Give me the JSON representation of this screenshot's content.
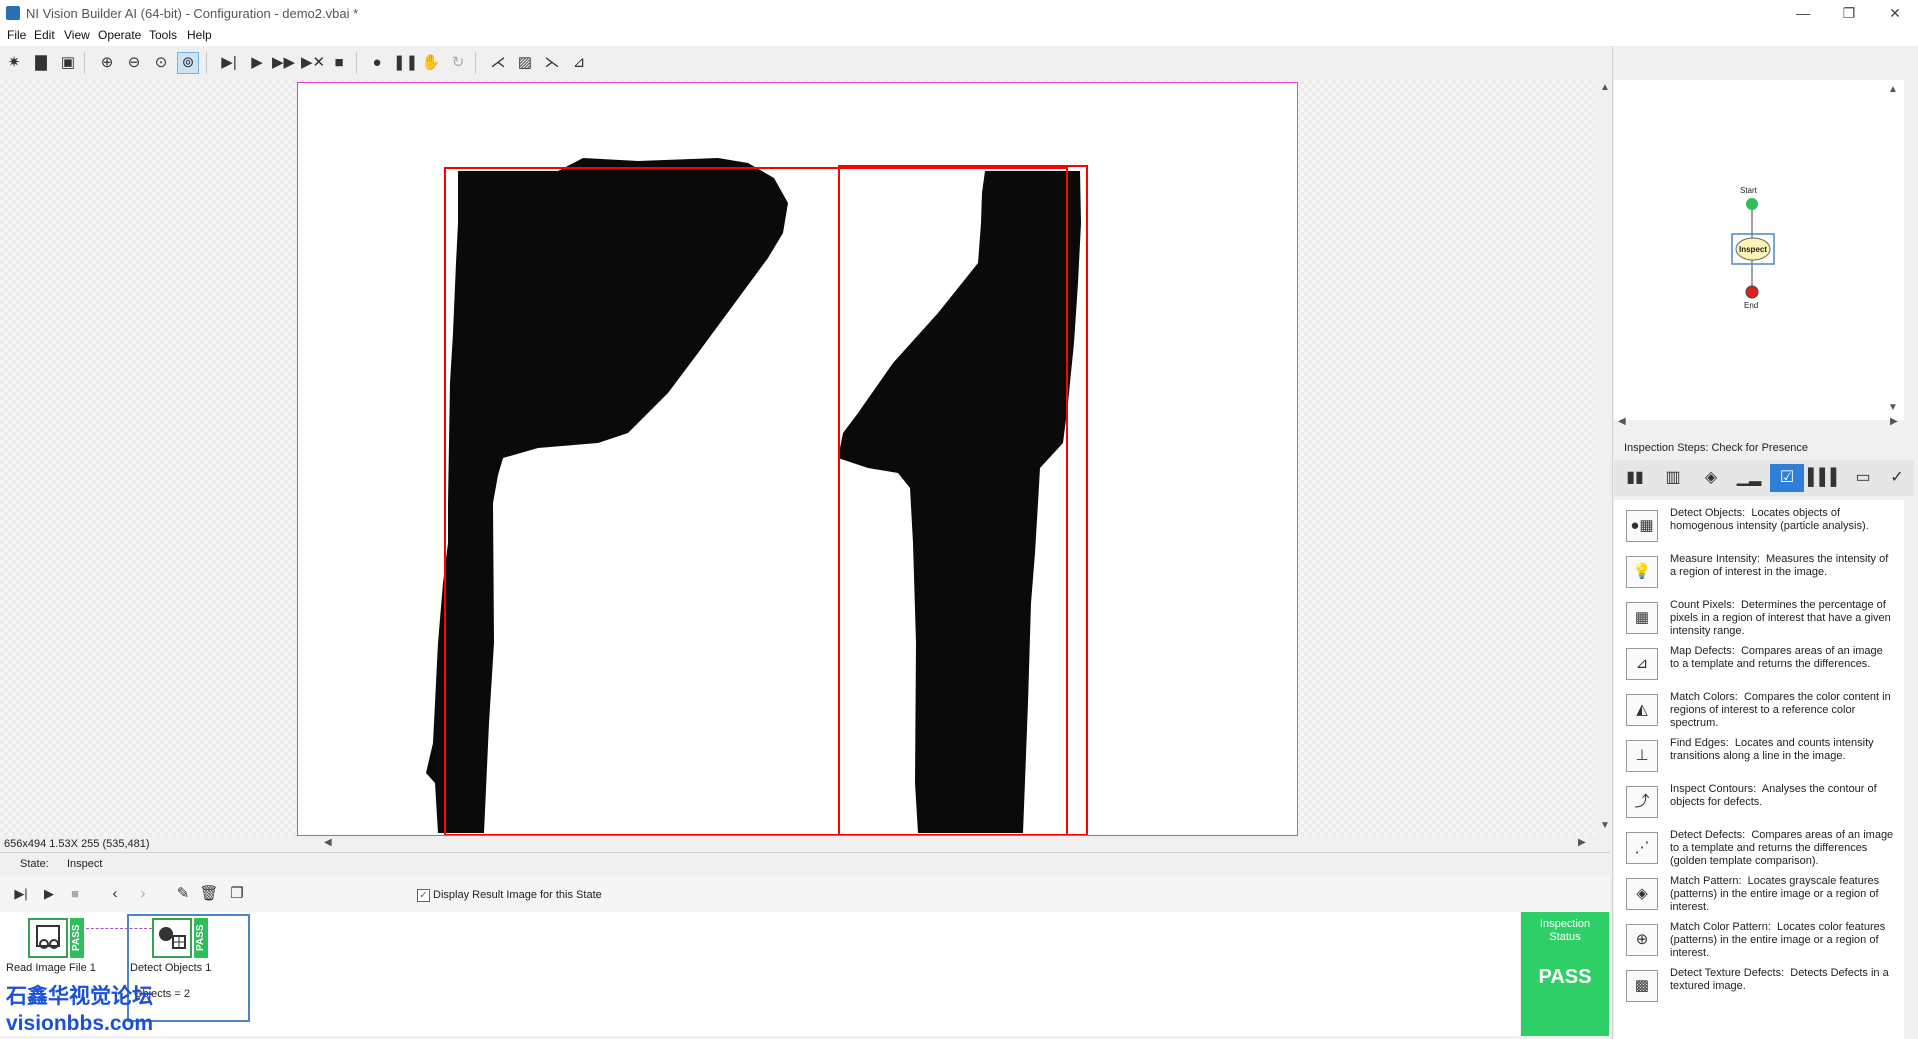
{
  "window": {
    "title": "NI Vision Builder AI (64-bit) - Configuration - demo2.vbai *",
    "min": "—",
    "restore": "❐",
    "close": "✕"
  },
  "menu": [
    "File",
    "Edit",
    "View",
    "Operate",
    "Tools",
    "Help"
  ],
  "viewer": {
    "readout": "656x494 1.53X 255    (535,481)"
  },
  "state": {
    "label": "State:",
    "value": "Inspect",
    "display_result_label": "Display Result Image for this State",
    "display_result_checked": true
  },
  "steps": [
    {
      "name": "Read Image File 1",
      "status": "PASS",
      "icon": "read-image-icon"
    },
    {
      "name": "Detect Objects 1",
      "status": "PASS",
      "icon": "detect-objects-icon",
      "result": "Objects = 2"
    }
  ],
  "inspection_status": {
    "label": "Inspection Status",
    "value": "PASS"
  },
  "flow": {
    "start": "Start",
    "state": "Inspect",
    "end": "End"
  },
  "palette": {
    "title": "Inspection Steps: Check for Presence",
    "items": [
      {
        "name": "Detect Objects:",
        "desc": "Locates objects of homogenous intensity (particle analysis).",
        "icon": "detect-objects-icon"
      },
      {
        "name": "Measure Intensity:",
        "desc": "Measures the intensity of a region of interest in the image.",
        "icon": "measure-intensity-icon"
      },
      {
        "name": "Count Pixels:",
        "desc": "Determines the percentage of pixels in a region of interest that have a given intensity range.",
        "icon": "count-pixels-icon"
      },
      {
        "name": "Map Defects:",
        "desc": "Compares areas of an image to a template and returns the differences.",
        "icon": "map-defects-icon"
      },
      {
        "name": "Match Colors:",
        "desc": "Compares the color content in regions of interest to a reference color spectrum.",
        "icon": "match-colors-icon"
      },
      {
        "name": "Find Edges:",
        "desc": "Locates and counts intensity transitions along a line in the image.",
        "icon": "find-edges-icon"
      },
      {
        "name": "Inspect Contours:",
        "desc": "Analyses the contour of objects for defects.",
        "icon": "inspect-contours-icon"
      },
      {
        "name": "Detect Defects:",
        "desc": "Compares areas of an image to a template and returns the differences (golden template comparison).",
        "icon": "detect-defects-icon"
      },
      {
        "name": "Match Pattern:",
        "desc": "Locates grayscale features (patterns) in the entire image or a region of interest.",
        "icon": "match-pattern-icon"
      },
      {
        "name": "Match Color Pattern:",
        "desc": "Locates color features (patterns) in the entire image or a region of interest.",
        "icon": "match-color-pattern-icon"
      },
      {
        "name": "Detect Texture Defects:",
        "desc": "Detects Defects in a textured image.",
        "icon": "detect-texture-defects-icon"
      }
    ]
  },
  "watermark": {
    "line1": "石鑫华视觉论坛",
    "line2": "visionbbs.com"
  },
  "colors": {
    "pass": "#2fcf67",
    "roi": "#ff0000",
    "canvas_border": "#e040e0",
    "active_tab": "#2f7fd8"
  }
}
